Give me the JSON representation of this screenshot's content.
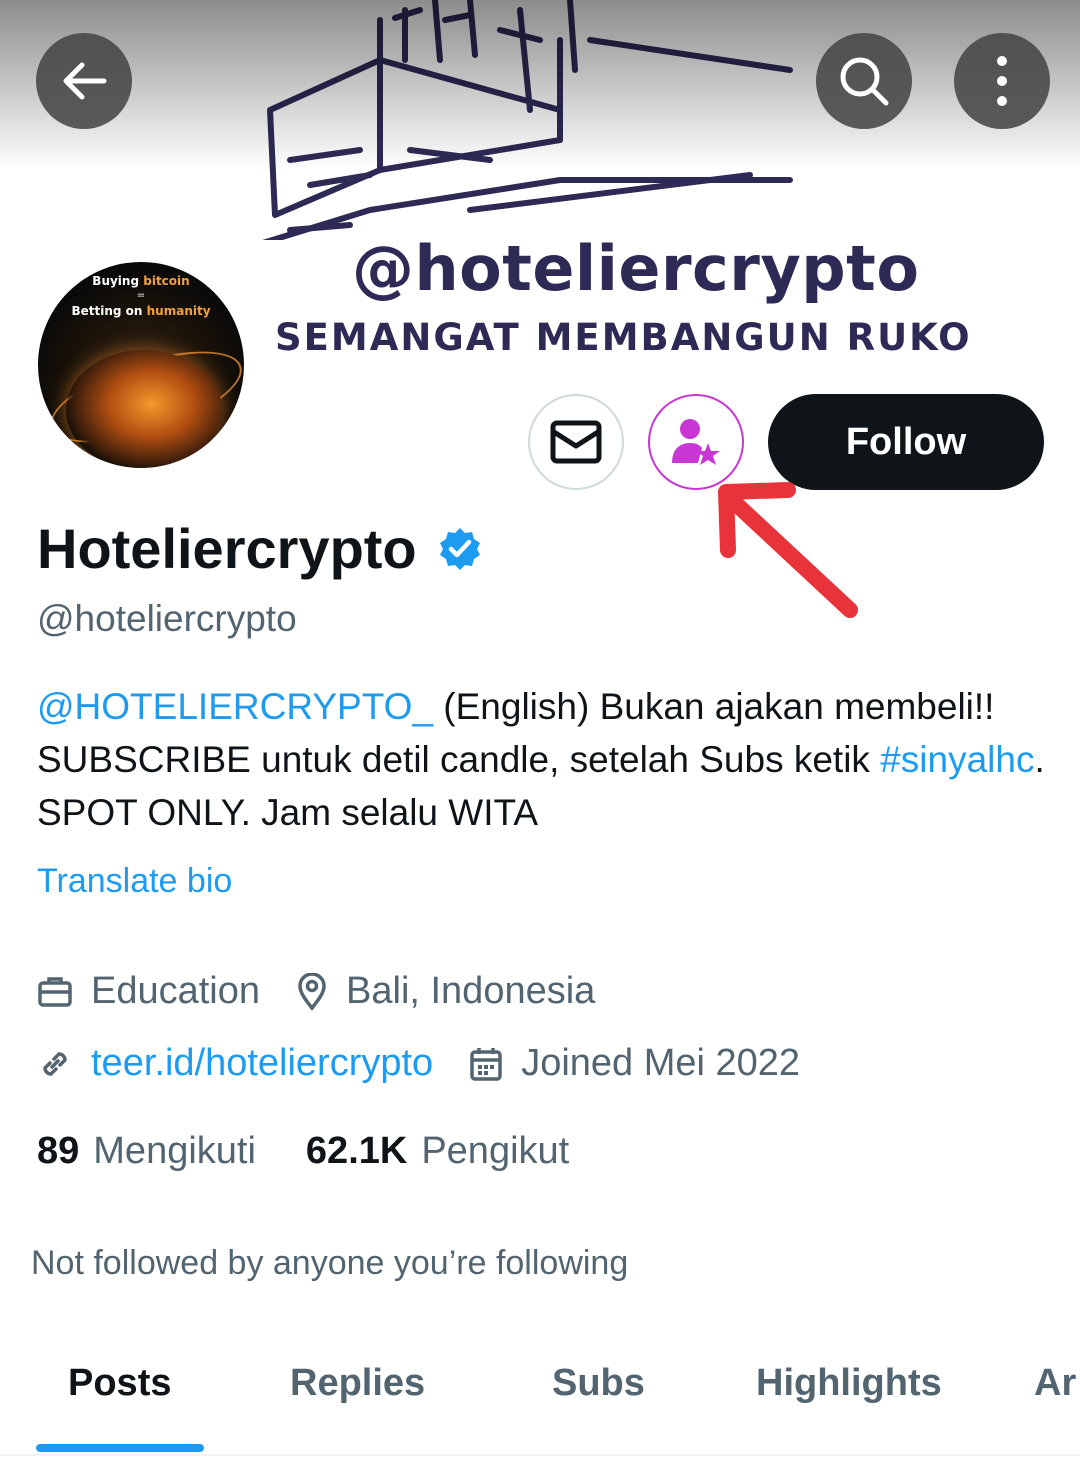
{
  "header": {
    "banner_handle": "@hoteliercrypto",
    "banner_slogan": "SEMANGAT MEMBANGUN RUKO",
    "back_icon": "arrow-left-icon",
    "search_icon": "search-icon",
    "more_icon": "more-vertical-icon"
  },
  "avatar": {
    "line1_a": "Buying ",
    "line1_b": "bitcoin",
    "line_mid": "=",
    "line2_a": "Betting on ",
    "line2_b": "humanity"
  },
  "actions": {
    "message_icon": "mail-icon",
    "subscribe_icon": "subscribe-user-star-icon",
    "follow_label": "Follow",
    "subscribe_color": "#c837d4"
  },
  "profile": {
    "display_name": "Hoteliercrypto",
    "handle": "@hoteliercrypto",
    "verified": true,
    "bio_mention": "@HOTELIERCRYPTO_",
    "bio_part1": " (English) Bukan ajakan membeli!! SUBSCRIBE untuk detil candle, setelah Subs ketik ",
    "bio_hashtag": "#sinyalhc",
    "bio_part2": ". SPOT ONLY. Jam selalu WITA",
    "translate_label": "Translate bio",
    "category": "Education",
    "location": "Bali, Indonesia",
    "website": "teer.id/hoteliercrypto",
    "joined": "Joined Mei 2022"
  },
  "stats": {
    "following_count": "89",
    "following_label": "Mengikuti",
    "followers_count": "62.1K",
    "followers_label": "Pengikut"
  },
  "social_context": "Not followed by anyone you’re following",
  "tabs": [
    {
      "label": "Posts",
      "active": true
    },
    {
      "label": "Replies",
      "active": false
    },
    {
      "label": "Subs",
      "active": false
    },
    {
      "label": "Highlights",
      "active": false
    },
    {
      "label": "Ar",
      "active": false
    }
  ],
  "colors": {
    "accent": "#1d9bf0",
    "text": "#0f1419",
    "muted": "#536471",
    "annotation_arrow": "#e8333a"
  }
}
